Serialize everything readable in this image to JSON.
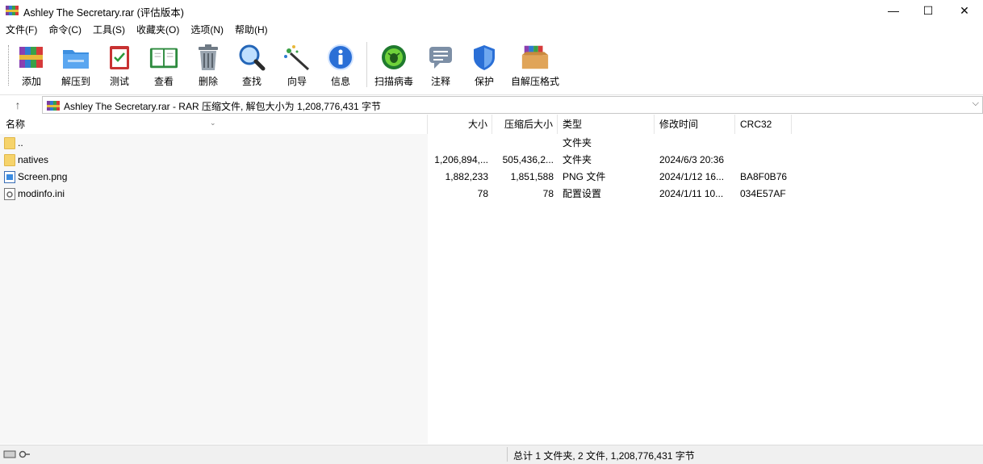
{
  "window": {
    "title": "Ashley The Secretary.rar (评估版本)",
    "min_glyph": "—",
    "max_glyph": "☐",
    "close_glyph": "✕"
  },
  "menu": [
    "文件(F)",
    "命令(C)",
    "工具(S)",
    "收藏夹(O)",
    "选项(N)",
    "帮助(H)"
  ],
  "toolbar": [
    {
      "label": "添加",
      "icon": "winrar-books-icon"
    },
    {
      "label": "解压到",
      "icon": "extract-folder-icon"
    },
    {
      "label": "测试",
      "icon": "test-clipboard-icon"
    },
    {
      "label": "查看",
      "icon": "view-book-icon"
    },
    {
      "label": "删除",
      "icon": "trash-can-icon"
    },
    {
      "label": "查找",
      "icon": "magnifier-icon"
    },
    {
      "label": "向导",
      "icon": "wizard-wand-icon"
    },
    {
      "label": "信息",
      "icon": "info-icon"
    },
    {
      "label": "扫描病毒",
      "icon": "virus-scan-icon"
    },
    {
      "label": "注释",
      "icon": "comment-icon"
    },
    {
      "label": "保护",
      "icon": "shield-icon"
    },
    {
      "label": "自解压格式",
      "icon": "sfx-box-icon"
    }
  ],
  "address": {
    "up_glyph": "↑",
    "path": "Ashley The Secretary.rar - RAR 压缩文件, 解包大小为 1,208,776,431 字节",
    "dropdown_glyph": "⌵"
  },
  "columns": {
    "name": "名称",
    "size": "大小",
    "packed": "压缩后大小",
    "type": "类型",
    "mtime": "修改时间",
    "crc": "CRC32",
    "sort_glyph": "⌄"
  },
  "files": [
    {
      "name": "..",
      "size": "",
      "packed": "",
      "type": "文件夹",
      "mtime": "",
      "crc": "",
      "icon": "folder-icon"
    },
    {
      "name": "natives",
      "size": "1,206,894,...",
      "packed": "505,436,2...",
      "type": "文件夹",
      "mtime": "2024/6/3 20:36",
      "crc": "",
      "icon": "folder-icon"
    },
    {
      "name": "Screen.png",
      "size": "1,882,233",
      "packed": "1,851,588",
      "type": "PNG 文件",
      "mtime": "2024/1/12 16...",
      "crc": "BA8F0B76",
      "icon": "png-file-icon"
    },
    {
      "name": "modinfo.ini",
      "size": "78",
      "packed": "78",
      "type": "配置设置",
      "mtime": "2024/1/11 10...",
      "crc": "034E57AF",
      "icon": "ini-file-icon"
    }
  ],
  "status": {
    "summary": "总计 1 文件夹, 2 文件, 1,208,776,431 字节"
  },
  "colors": {
    "accent_blue": "#2a6fd6",
    "folder_yellow": "#f6d36b"
  }
}
